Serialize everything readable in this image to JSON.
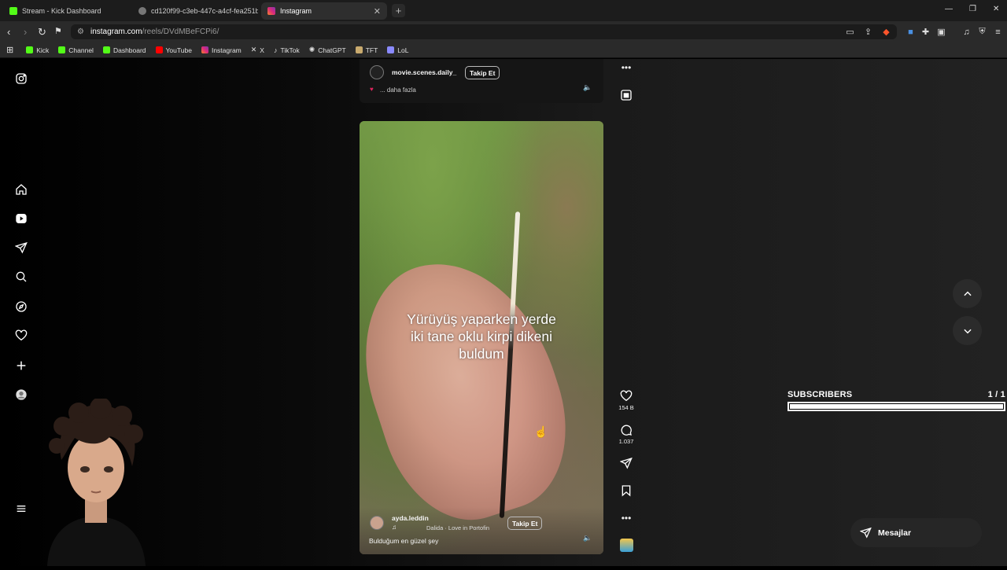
{
  "tabs": [
    {
      "title": "Stream - Kick Dashboard",
      "color": "#53fc18"
    },
    {
      "title": "cd120f99-c3eb-447c-a4cf-fea251b1",
      "color": "#9a9a9a"
    },
    {
      "title": "Instagram",
      "color": "#e1306c",
      "active": true
    }
  ],
  "address": {
    "host": "instagram.com",
    "path": "/reels/DVdMBeFCPi6/"
  },
  "bookmarks": [
    {
      "label": "Kick",
      "color": "#53fc18"
    },
    {
      "label": "Channel",
      "color": "#53fc18"
    },
    {
      "label": "Dashboard",
      "color": "#53fc18"
    },
    {
      "label": "YouTube",
      "color": "#ff0000"
    },
    {
      "label": "Instagram",
      "color": "#e1306c"
    },
    {
      "label": "X",
      "color": "#dddddd"
    },
    {
      "label": "TikTok",
      "color": "#dddddd"
    },
    {
      "label": "ChatGPT",
      "color": "#cccccc"
    },
    {
      "label": "TFT",
      "color": "#c8aa6e"
    },
    {
      "label": "LoL",
      "color": "#8a8aff"
    }
  ],
  "prev_reel": {
    "username": "movie.scenes.daily_",
    "follow_label": "Takip Et",
    "caption": "... daha fazla"
  },
  "reel": {
    "overlay_text_lines": [
      "Yürüyüş yaparken yerde",
      "iki tane oklu kirpi dikeni",
      "buldum"
    ],
    "username": "ayda.leddin",
    "music": "Dalida · Love in Portofin",
    "follow_label": "Takip Et",
    "caption": "Bulduğum en güzel şey"
  },
  "actions": {
    "likes": "154 B",
    "comments": "1.037"
  },
  "subscribers": {
    "label": "SUBSCRIBERS",
    "count": "1 / 1",
    "progress": 1.0
  },
  "messages_label": "Mesajlar"
}
